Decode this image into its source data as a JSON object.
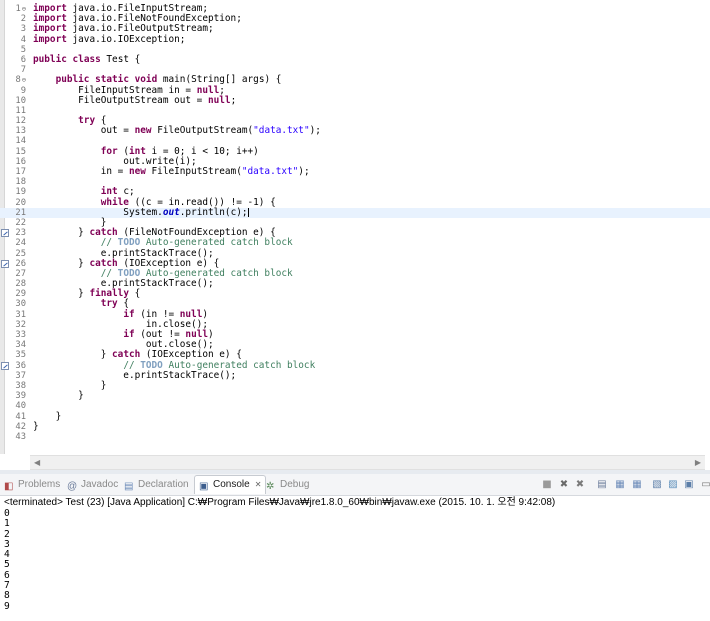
{
  "editor": {
    "lines": [
      {
        "n": "1",
        "fold": true,
        "tokens": [
          [
            "kw",
            "import"
          ],
          [
            "t",
            " java.io.FileInputStream;"
          ]
        ]
      },
      {
        "n": "2",
        "tokens": [
          [
            "kw",
            "import"
          ],
          [
            "t",
            " java.io.FileNotFoundException;"
          ]
        ]
      },
      {
        "n": "3",
        "tokens": [
          [
            "kw",
            "import"
          ],
          [
            "t",
            " java.io.FileOutputStream;"
          ]
        ]
      },
      {
        "n": "4",
        "tokens": [
          [
            "kw",
            "import"
          ],
          [
            "t",
            " java.io.IOException;"
          ]
        ]
      },
      {
        "n": "5",
        "tokens": []
      },
      {
        "n": "6",
        "tokens": [
          [
            "kw",
            "public"
          ],
          [
            "t",
            " "
          ],
          [
            "kw",
            "class"
          ],
          [
            "t",
            " Test {"
          ]
        ]
      },
      {
        "n": "7",
        "tokens": []
      },
      {
        "n": "8",
        "fold": true,
        "tokens": [
          [
            "t",
            "    "
          ],
          [
            "kw",
            "public"
          ],
          [
            "t",
            " "
          ],
          [
            "kw",
            "static"
          ],
          [
            "t",
            " "
          ],
          [
            "kw",
            "void"
          ],
          [
            "t",
            " main(String[] args) {"
          ]
        ]
      },
      {
        "n": "9",
        "tokens": [
          [
            "t",
            "        FileInputStream in = "
          ],
          [
            "kw",
            "null"
          ],
          [
            "t",
            ";"
          ]
        ]
      },
      {
        "n": "10",
        "tokens": [
          [
            "t",
            "        FileOutputStream out = "
          ],
          [
            "kw",
            "null"
          ],
          [
            "t",
            ";"
          ]
        ]
      },
      {
        "n": "11",
        "tokens": []
      },
      {
        "n": "12",
        "tokens": [
          [
            "t",
            "        "
          ],
          [
            "kw",
            "try"
          ],
          [
            "t",
            " {"
          ]
        ]
      },
      {
        "n": "13",
        "tokens": [
          [
            "t",
            "            out = "
          ],
          [
            "kw",
            "new"
          ],
          [
            "t",
            " FileOutputStream("
          ],
          [
            "str",
            "\"data.txt\""
          ],
          [
            "t",
            ");"
          ]
        ]
      },
      {
        "n": "14",
        "tokens": []
      },
      {
        "n": "15",
        "tokens": [
          [
            "t",
            "            "
          ],
          [
            "kw",
            "for"
          ],
          [
            "t",
            " ("
          ],
          [
            "kw",
            "int"
          ],
          [
            "t",
            " i = 0; i < 10; i++)"
          ]
        ]
      },
      {
        "n": "16",
        "tokens": [
          [
            "t",
            "                out.write(i);"
          ]
        ]
      },
      {
        "n": "17",
        "tokens": [
          [
            "t",
            "            in = "
          ],
          [
            "kw",
            "new"
          ],
          [
            "t",
            " FileInputStream("
          ],
          [
            "str",
            "\"data.txt\""
          ],
          [
            "t",
            ");"
          ]
        ]
      },
      {
        "n": "18",
        "tokens": []
      },
      {
        "n": "19",
        "tokens": [
          [
            "t",
            "            "
          ],
          [
            "kw",
            "int"
          ],
          [
            "t",
            " c;"
          ]
        ]
      },
      {
        "n": "20",
        "tokens": [
          [
            "t",
            "            "
          ],
          [
            "kw",
            "while"
          ],
          [
            "t",
            " ((c = in.read()) != -1) {"
          ]
        ]
      },
      {
        "n": "21",
        "current": true,
        "tokens": [
          [
            "t",
            "                System."
          ],
          [
            "fld",
            "out"
          ],
          [
            "t",
            ".println(c);"
          ],
          [
            "caret",
            ""
          ]
        ]
      },
      {
        "n": "22",
        "tokens": [
          [
            "t",
            "            }"
          ]
        ]
      },
      {
        "n": "23",
        "qf": true,
        "tokens": [
          [
            "t",
            "        } "
          ],
          [
            "kw",
            "catch"
          ],
          [
            "t",
            " (FileNotFoundException e) {"
          ]
        ]
      },
      {
        "n": "24",
        "tokens": [
          [
            "t",
            "            "
          ],
          [
            "cm",
            "// "
          ],
          [
            "todo",
            "TODO"
          ],
          [
            "cm",
            " Auto-generated catch block"
          ]
        ]
      },
      {
        "n": "25",
        "tokens": [
          [
            "t",
            "            e.printStackTrace();"
          ]
        ]
      },
      {
        "n": "26",
        "qf": true,
        "tokens": [
          [
            "t",
            "        } "
          ],
          [
            "kw",
            "catch"
          ],
          [
            "t",
            " (IOException e) {"
          ]
        ]
      },
      {
        "n": "27",
        "tokens": [
          [
            "t",
            "            "
          ],
          [
            "cm",
            "// "
          ],
          [
            "todo",
            "TODO"
          ],
          [
            "cm",
            " Auto-generated catch block"
          ]
        ]
      },
      {
        "n": "28",
        "tokens": [
          [
            "t",
            "            e.printStackTrace();"
          ]
        ]
      },
      {
        "n": "29",
        "tokens": [
          [
            "t",
            "        } "
          ],
          [
            "kw",
            "finally"
          ],
          [
            "t",
            " {"
          ]
        ]
      },
      {
        "n": "30",
        "tokens": [
          [
            "t",
            "            "
          ],
          [
            "kw",
            "try"
          ],
          [
            "t",
            " {"
          ]
        ]
      },
      {
        "n": "31",
        "tokens": [
          [
            "t",
            "                "
          ],
          [
            "kw",
            "if"
          ],
          [
            "t",
            " (in != "
          ],
          [
            "kw",
            "null"
          ],
          [
            "t",
            ")"
          ]
        ]
      },
      {
        "n": "32",
        "tokens": [
          [
            "t",
            "                    in.close();"
          ]
        ]
      },
      {
        "n": "33",
        "tokens": [
          [
            "t",
            "                "
          ],
          [
            "kw",
            "if"
          ],
          [
            "t",
            " (out != "
          ],
          [
            "kw",
            "null"
          ],
          [
            "t",
            ")"
          ]
        ]
      },
      {
        "n": "34",
        "tokens": [
          [
            "t",
            "                    out.close();"
          ]
        ]
      },
      {
        "n": "35",
        "tokens": [
          [
            "t",
            "            } "
          ],
          [
            "kw",
            "catch"
          ],
          [
            "t",
            " (IOException e) {"
          ]
        ]
      },
      {
        "n": "36",
        "qf": true,
        "tokens": [
          [
            "t",
            "                "
          ],
          [
            "cm",
            "// "
          ],
          [
            "todo",
            "TODO"
          ],
          [
            "cm",
            " Auto-generated catch block"
          ]
        ]
      },
      {
        "n": "37",
        "tokens": [
          [
            "t",
            "                e.printStackTrace();"
          ]
        ]
      },
      {
        "n": "38",
        "tokens": [
          [
            "t",
            "            }"
          ]
        ]
      },
      {
        "n": "39",
        "tokens": [
          [
            "t",
            "        }"
          ]
        ]
      },
      {
        "n": "40",
        "tokens": []
      },
      {
        "n": "41",
        "tokens": [
          [
            "t",
            "    }"
          ]
        ]
      },
      {
        "n": "42",
        "tokens": [
          [
            "t",
            "}"
          ]
        ]
      },
      {
        "n": "43",
        "tokens": []
      }
    ]
  },
  "tabs": [
    {
      "label": "Problems",
      "icon": "problems-icon",
      "active": false
    },
    {
      "label": "Javadoc",
      "icon": "javadoc-icon",
      "active": false
    },
    {
      "label": "Declaration",
      "icon": "declaration-icon",
      "active": false
    },
    {
      "label": "Console",
      "icon": "console-icon",
      "active": true,
      "close": "✕"
    },
    {
      "label": "Debug",
      "icon": "debug-icon",
      "active": false
    }
  ],
  "toolbar_icons": [
    "terminate-icon",
    "remove-launch-icon",
    "remove-all-icon",
    "scroll-lock-icon",
    "show-stdout-icon",
    "show-stderr-icon",
    "pin-console-icon",
    "display-console-icon",
    "open-console-icon",
    "minimize-icon",
    "maximize-icon"
  ],
  "console": {
    "header": "<terminated> Test (23) [Java Application] C:₩Program Files₩Java₩jre1.8.0_60₩bin₩javaw.exe (2015. 10. 1. 오전 9:42:08)",
    "output": [
      "0",
      "1",
      "2",
      "3",
      "4",
      "5",
      "6",
      "7",
      "8",
      "9"
    ]
  },
  "colors": {
    "keyword": "#7f0055",
    "string": "#2a00ff",
    "comment": "#3f7f5f",
    "todo": "#7f9fbf",
    "field": "#0000c0",
    "current_line": "#e8f2fe"
  }
}
